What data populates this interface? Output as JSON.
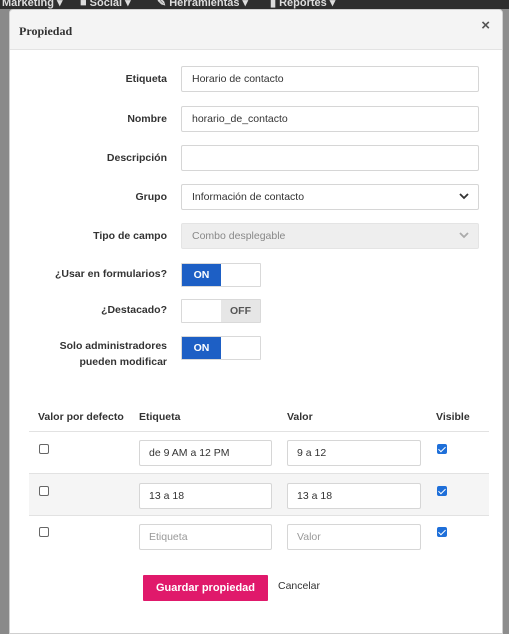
{
  "topnav": {
    "items": [
      {
        "label": "Marketing",
        "icon": "caret-down-icon"
      },
      {
        "label": "Social",
        "icon": "chat-icon"
      },
      {
        "label": "Herramientas",
        "icon": "wrench-icon"
      },
      {
        "label": "Reportes",
        "icon": "bar-chart-icon"
      }
    ]
  },
  "modal": {
    "title": "Propiedad",
    "close_label": "×"
  },
  "form": {
    "etiqueta": {
      "label": "Etiqueta",
      "value": "Horario de contacto"
    },
    "nombre": {
      "label": "Nombre",
      "value": "horario_de_contacto"
    },
    "descripcion": {
      "label": "Descripción",
      "value": ""
    },
    "grupo": {
      "label": "Grupo",
      "value": "Información de contacto"
    },
    "tipo_campo": {
      "label": "Tipo de campo",
      "value": "Combo desplegable"
    },
    "usar_formularios": {
      "label": "¿Usar en formularios?",
      "state_label": "ON",
      "value": true
    },
    "destacado": {
      "label": "¿Destacado?",
      "state_label": "OFF",
      "value": false
    },
    "solo_admin": {
      "label_line1": "Solo administradores",
      "label_line2": "pueden modificar",
      "state_label": "ON",
      "value": true
    }
  },
  "options_table": {
    "headers": {
      "default": "Valor por defecto",
      "etiqueta": "Etiqueta",
      "valor": "Valor",
      "visible": "Visible"
    },
    "rows": [
      {
        "default": false,
        "etiqueta": "de 9 AM a 12 PM",
        "valor": "9 a 12",
        "visible": true
      },
      {
        "default": false,
        "etiqueta": "13 a 18",
        "valor": "13 a 18",
        "visible": true
      },
      {
        "default": false,
        "etiqueta": "",
        "valor": "",
        "visible": true
      }
    ],
    "placeholders": {
      "etiqueta": "Etiqueta",
      "valor": "Valor"
    }
  },
  "actions": {
    "save_label": "Guardar propiedad",
    "cancel_label": "Cancelar"
  },
  "colors": {
    "toggle_on": "#1d5fc5",
    "save_button": "#e0196b",
    "checkbox_checked": "#1e6fd9"
  }
}
